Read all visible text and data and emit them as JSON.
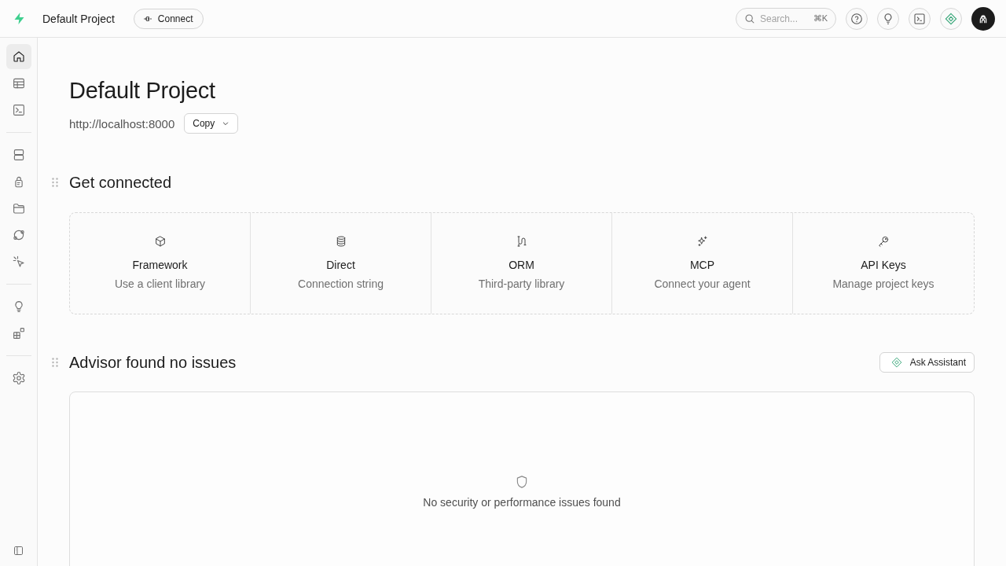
{
  "header": {
    "project": "Default Project",
    "connect_button": "Connect",
    "search": {
      "placeholder": "Search...",
      "shortcut": "⌘K"
    }
  },
  "sidebar": {
    "groups": [
      [
        {
          "selected": true
        },
        {
          "selected": false
        },
        {
          "selected": false
        }
      ],
      [
        {
          "selected": false
        },
        {
          "selected": false
        },
        {
          "selected": false
        },
        {
          "selected": false
        },
        {
          "selected": false
        }
      ],
      [
        {
          "selected": false
        },
        {
          "selected": false
        }
      ],
      [
        {
          "selected": false
        }
      ]
    ]
  },
  "page": {
    "title": "Default Project",
    "url": "http://localhost:8000",
    "copy_button": "Copy"
  },
  "get_connected": {
    "title": "Get connected",
    "options": [
      {
        "title": "Framework",
        "subtitle": "Use a client library"
      },
      {
        "title": "Direct",
        "subtitle": "Connection string"
      },
      {
        "title": "ORM",
        "subtitle": "Third-party library"
      },
      {
        "title": "MCP",
        "subtitle": "Connect your agent"
      },
      {
        "title": "API Keys",
        "subtitle": "Manage project keys"
      }
    ]
  },
  "advisor": {
    "title": "Advisor found no issues",
    "button": "Ask Assistant",
    "empty_message": "No security or performance issues found"
  }
}
